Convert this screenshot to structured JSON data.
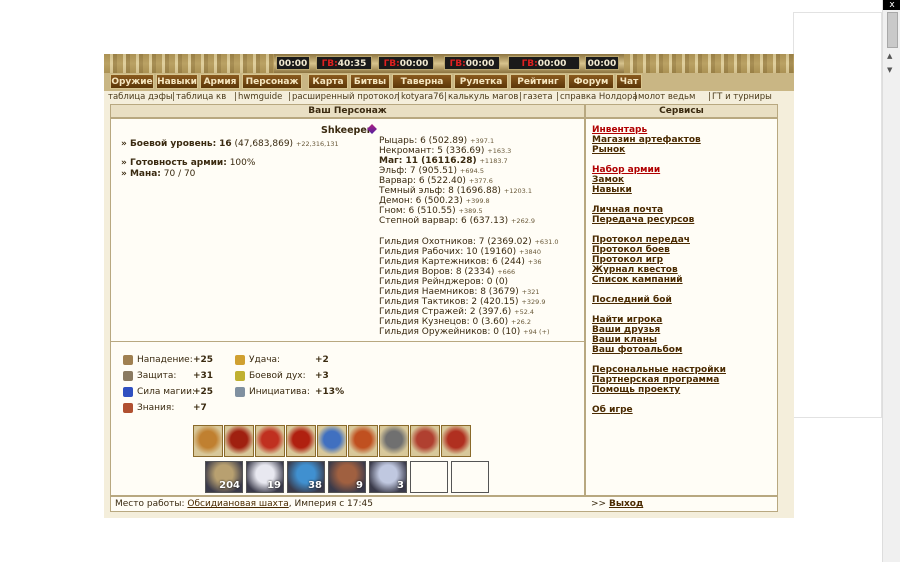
{
  "timers": [
    {
      "value": "00:00",
      "prefix": ""
    },
    {
      "value": "40:35",
      "prefix": "ГВ:"
    },
    {
      "value": "00:00",
      "prefix": "ГВ:"
    },
    {
      "value": "00:00",
      "prefix": "ГВ:"
    },
    {
      "value": "00:00",
      "prefix": "ГВ:"
    },
    {
      "value": "00:00",
      "prefix": ""
    }
  ],
  "nav": [
    "Оружие",
    "Навыки",
    "Армия",
    "Персонаж",
    "Карта",
    "Битвы",
    "Таверна",
    "Рулетка",
    "Рейтинг",
    "Форум",
    "Чат"
  ],
  "links": [
    "таблица дэфы",
    "|",
    "таблица кв",
    "|",
    "hwmguide",
    "|",
    "расширенный протокол",
    "|",
    "kotyara76",
    "|",
    "калькуль магов",
    "|",
    "газета",
    "|",
    "справка Нолдора",
    "|",
    "молот ведьм",
    "|",
    "ГТ и турниры"
  ],
  "left_header": "Ваш Персонаж",
  "right_header": "Сервисы",
  "player": {
    "name": "Shkeeper",
    "level_label": "» Боевой уровень:",
    "level": "16",
    "level_exp": "(47,683,869)",
    "level_exp_plus": "+22,316,131",
    "army_label": "» Готовность армии:",
    "army_value": "100%",
    "mana_label": "» Мана:",
    "mana_value": "70 / 70"
  },
  "factions": [
    {
      "label": "Рыцарь: 6 (502.89)",
      "plus": "+397.1",
      "bold": false
    },
    {
      "label": "Некромант: 5 (336.69)",
      "plus": "+163.3",
      "bold": false
    },
    {
      "label": "Маг: 11 (16116.28)",
      "plus": "+1183.7",
      "bold": true
    },
    {
      "label": "Эльф: 7 (905.51)",
      "plus": "+694.5",
      "bold": false
    },
    {
      "label": "Варвар: 6 (522.40)",
      "plus": "+377.6",
      "bold": false
    },
    {
      "label": "Темный эльф: 8 (1696.88)",
      "plus": "+1203.1",
      "bold": false
    },
    {
      "label": "Демон: 6 (500.23)",
      "plus": "+399.8",
      "bold": false
    },
    {
      "label": "Гном: 6 (510.55)",
      "plus": "+389.5",
      "bold": false
    },
    {
      "label": "Степной варвар: 6 (637.13)",
      "plus": "+262.9",
      "bold": false
    }
  ],
  "guilds": [
    {
      "label": "Гильдия Охотников: 7 (2369.02)",
      "plus": "+631.0"
    },
    {
      "label": "Гильдия Рабочих: 10 (19160)",
      "plus": "+3840"
    },
    {
      "label": "Гильдия Картежников: 6 (244)",
      "plus": "+36"
    },
    {
      "label": "Гильдия Воров: 8 (2334)",
      "plus": "+666"
    },
    {
      "label": "Гильдия Рейнджеров: 0 (0)",
      "plus": ""
    },
    {
      "label": "Гильдия Наемников: 8 (3679)",
      "plus": "+321"
    },
    {
      "label": "Гильдия Тактиков: 2 (420.15)",
      "plus": "+329.9"
    },
    {
      "label": "Гильдия Стражей: 2 (397.6)",
      "plus": "+52.4"
    },
    {
      "label": "Гильдия Кузнецов: 0 (3.60)",
      "plus": "+26.2"
    },
    {
      "label": "Гильдия Оружейников: 0 (10)",
      "plus": "+94 (+)"
    }
  ],
  "stats_left": [
    {
      "label": "Нападение:",
      "value": "+25",
      "icon": "swords-icon",
      "color": "#a08050"
    },
    {
      "label": "Защита:",
      "value": "+31",
      "icon": "shield-icon",
      "color": "#8a7a60"
    },
    {
      "label": "Сила магии:",
      "value": "+25",
      "icon": "wand-icon",
      "color": "#3050c0"
    },
    {
      "label": "Знания:",
      "value": "+7",
      "icon": "book-icon",
      "color": "#b05030"
    }
  ],
  "stats_right": [
    {
      "label": "Удача:",
      "value": "+2",
      "icon": "rainbow-icon",
      "color": "#d0a030"
    },
    {
      "label": "Боевой дух:",
      "value": "+3",
      "icon": "wings-icon",
      "color": "#c0b030"
    },
    {
      "label": "Инициатива:",
      "value": "+13%",
      "icon": "hourglass-icon",
      "color": "#8090a0"
    }
  ],
  "army": [
    "204",
    "19",
    "38",
    "9",
    "3",
    "",
    ""
  ],
  "workplace": {
    "label": "Место работы:",
    "place": "Обсидиановая шахта",
    "rest": ", Империя с 17:45"
  },
  "services": [
    {
      "text": "Инвентарь",
      "red": true,
      "gap": false
    },
    {
      "text": "Магазин артефактов",
      "red": false,
      "gap": false
    },
    {
      "text": "Рынок",
      "red": false,
      "gap": false
    },
    {
      "text": "Набор армии",
      "red": true,
      "gap": true
    },
    {
      "text": "Замок",
      "red": false,
      "gap": false
    },
    {
      "text": "Навыки",
      "red": false,
      "gap": false
    },
    {
      "text": "Личная почта",
      "red": false,
      "gap": true
    },
    {
      "text": "Передача ресурсов",
      "red": false,
      "gap": false
    },
    {
      "text": "Протокол передач",
      "red": false,
      "gap": true
    },
    {
      "text": "Протокол боев",
      "red": false,
      "gap": false
    },
    {
      "text": "Протокол игр",
      "red": false,
      "gap": false
    },
    {
      "text": "Журнал квестов",
      "red": false,
      "gap": false
    },
    {
      "text": "Список кампаний",
      "red": false,
      "gap": false
    },
    {
      "text": "Последний бой",
      "red": false,
      "gap": true
    },
    {
      "text": "Найти игрока",
      "red": false,
      "gap": true
    },
    {
      "text": "Ваши друзья",
      "red": false,
      "gap": false
    },
    {
      "text": "Ваши кланы",
      "red": false,
      "gap": false
    },
    {
      "text": "Ваш фотоальбом",
      "red": false,
      "gap": false
    },
    {
      "text": "Персональные настройки",
      "red": false,
      "gap": true
    },
    {
      "text": "Партнерская программа",
      "red": false,
      "gap": false
    },
    {
      "text": "Помощь проекту",
      "red": false,
      "gap": false
    },
    {
      "text": "Об игре",
      "red": false,
      "gap": true
    }
  ],
  "exit": {
    "prefix": ">>",
    "label": "Выход"
  },
  "window_close": "x"
}
